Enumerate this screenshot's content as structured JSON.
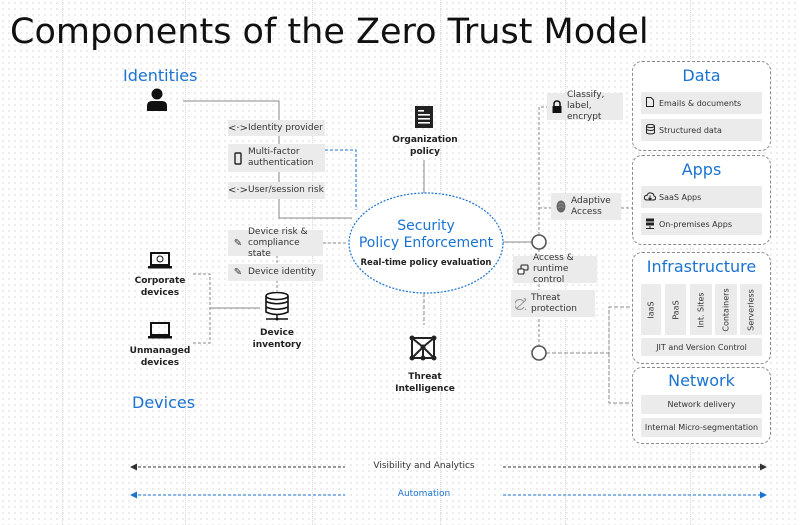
{
  "title": "Components of the Zero Trust Model",
  "sections": {
    "identities": "Identities",
    "devices": "Devices"
  },
  "identity_signals": [
    {
      "icon": "code-arrows-icon",
      "glyph": "<·>",
      "label": "Identity provider"
    },
    {
      "icon": "mobile-phone-icon",
      "glyph": "",
      "label": "Multi-factor authentication"
    },
    {
      "icon": "code-arrows-icon",
      "glyph": "<·>",
      "label": "User/session risk"
    }
  ],
  "device_signals": [
    {
      "icon": "pencil-icon",
      "label": "Device risk & compliance state"
    },
    {
      "icon": "pencil-icon",
      "label": "Device identity"
    }
  ],
  "devices": {
    "corporate": "Corporate devices",
    "unmanaged": "Unmanaged devices",
    "inventory": "Device inventory"
  },
  "org_policy": "Organization policy",
  "threat_intel": "Threat Intelligence",
  "enforcement": {
    "title_line1": "Security",
    "title_line2": "Policy Enforcement",
    "subtitle": "Real-time policy evaluation"
  },
  "controls": [
    {
      "icon": "lock-icon",
      "label": "Classify, label, encrypt"
    },
    {
      "icon": "fingerprint-icon",
      "label": "Adaptive Access"
    },
    {
      "icon": "devices-icon",
      "label": "Access & runtime control"
    },
    {
      "icon": "radar-icon",
      "label": "Threat protection"
    }
  ],
  "panels": {
    "data": {
      "title": "Data",
      "items": [
        {
          "icon": "document-icon",
          "label": "Emails & documents"
        },
        {
          "icon": "database-icon",
          "label": "Structured data"
        }
      ]
    },
    "apps": {
      "title": "Apps",
      "items": [
        {
          "icon": "cloud-icon",
          "label": "SaaS Apps"
        },
        {
          "icon": "server-icon",
          "label": "On-premises Apps"
        }
      ]
    },
    "infrastructure": {
      "title": "Infrastructure",
      "columns": [
        "IaaS",
        "PaaS",
        "Int. Sites",
        "Containers",
        "Serverless"
      ],
      "footer": "JIT and Version Control"
    },
    "network": {
      "title": "Network",
      "items": [
        "Network delivery",
        "Internal Micro-segmentation"
      ]
    }
  },
  "bottom": {
    "visibility": "Visibility and Analytics",
    "automation": "Automation"
  },
  "colors": {
    "accent": "#1a73d1",
    "box": "#ebebeb",
    "line": "#8a8a8a"
  }
}
